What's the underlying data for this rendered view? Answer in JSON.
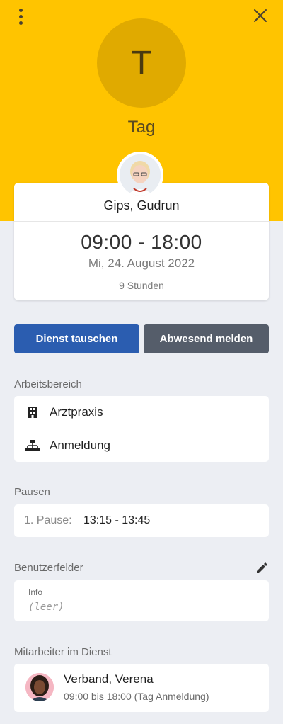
{
  "header": {
    "shift_initial": "T",
    "shift_name": "Tag",
    "color": "#FFC400"
  },
  "shift_card": {
    "employee_name": "Gips, Gudrun",
    "time_range": "09:00 - 18:00",
    "date": "Mi, 24. August 2022",
    "duration": "9 Stunden"
  },
  "actions": {
    "swap_label": "Dienst tauschen",
    "absent_label": "Abwesend melden"
  },
  "work_area": {
    "label": "Arbeitsbereich",
    "items": [
      {
        "icon": "building-icon",
        "text": "Arztpraxis"
      },
      {
        "icon": "org-chart-icon",
        "text": "Anmeldung"
      }
    ]
  },
  "breaks": {
    "label": "Pausen",
    "items": [
      {
        "label": "1. Pause:",
        "value": "13:15 - 13:45"
      }
    ]
  },
  "custom_fields": {
    "label": "Benutzerfelder",
    "edit_icon": "pencil-icon",
    "fields": [
      {
        "label": "Info",
        "value": "(leer)"
      }
    ]
  },
  "coworkers": {
    "label": "Mitarbeiter im Dienst",
    "items": [
      {
        "name": "Verband, Verena",
        "detail": "09:00 bis 18:00 (Tag Anmeldung)"
      }
    ]
  }
}
